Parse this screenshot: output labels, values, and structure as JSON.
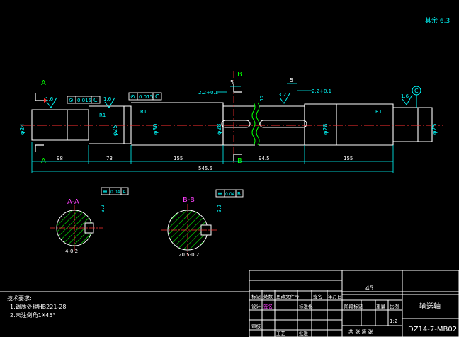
{
  "colors": {
    "background": "#000000",
    "outline": "#ffffff",
    "dimension": "#00ffff",
    "leader": "#00ff00",
    "centerline": "#ff3030",
    "section_label": "#ff40ff",
    "hatch": "#00ff00",
    "title_text": "#ffffff"
  },
  "roughness_note": "其余 6.3",
  "section_markers": {
    "a_top": "A",
    "a_bottom": "A",
    "b_top": "B",
    "b_bottom": "B",
    "c": "C"
  },
  "tolerance_frames": {
    "left_a": [
      "⊙",
      "0.015",
      "C"
    ],
    "left_b": [
      "⊙",
      "0.015",
      "C"
    ],
    "sec_a": [
      "≡",
      "0.04",
      "A"
    ],
    "sec_b": [
      "≡",
      "0.04",
      "B"
    ]
  },
  "roughness_marks": {
    "r1": "1.6",
    "r2": "1.6",
    "r3": "1.6",
    "r4": "1.6",
    "r5": "3.2",
    "r6": "1.6"
  },
  "fillets": {
    "f1": "R1",
    "f2": "R1",
    "f3": "R1"
  },
  "top_dims": {
    "keyway_a": "2.2+0.1",
    "keyway_b": "2.2+0.1",
    "key_a": "5",
    "key_b": "5",
    "gap": "12"
  },
  "diameters": {
    "d1": "φ24",
    "d2": "φ25",
    "d3": "φ30",
    "d4": "φ28",
    "d5": "φ28",
    "d6": "φ25"
  },
  "lengths": {
    "l1": "98",
    "l2": "73",
    "l3": "155",
    "l4": "94.5",
    "l5": "155",
    "total": "545.5"
  },
  "section_views": {
    "a_title": "A-A",
    "b_title": "B-B",
    "a_depth": "4-0.2",
    "b_depth": "20.5-0.2",
    "a_ra": "3.2",
    "b_ra": "3.2"
  },
  "notes": {
    "heading": "技术要求:",
    "line1": "1.调质处理HB221-28",
    "line2": "2.未注倒角1X45°"
  },
  "title_block": {
    "material": "45",
    "part_name": "输送轴",
    "drawing_no": "DZ14-7-MB02",
    "scale": "1:2",
    "sheet": "共 张 第 张",
    "header_cells": [
      "标记",
      "处数",
      "更改文件号",
      "签名",
      "年月日"
    ],
    "row2_cells": [
      "设计",
      "签名",
      "标准化",
      "阶段标记",
      "重量",
      "比例"
    ],
    "row3_cells": [
      "审核",
      "工艺",
      "批准"
    ]
  }
}
